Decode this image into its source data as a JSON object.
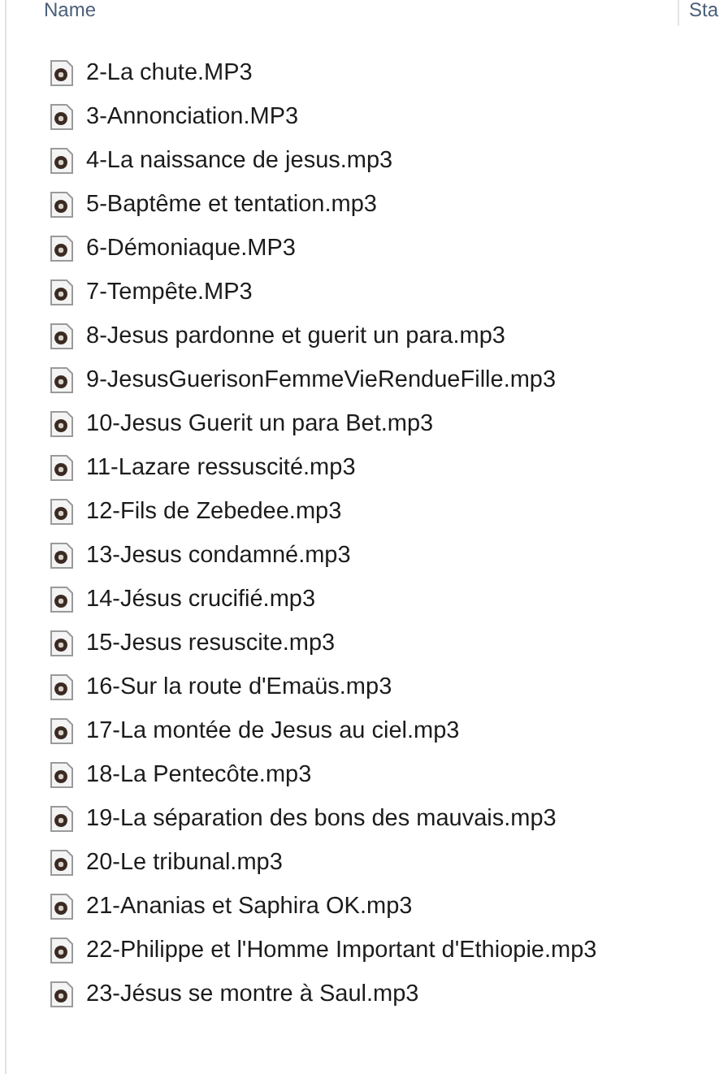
{
  "columns": [
    {
      "label": "Name"
    },
    {
      "label": "Sta"
    }
  ],
  "files": [
    {
      "name": "2-La chute.MP3"
    },
    {
      "name": "3-Annonciation.MP3"
    },
    {
      "name": "4-La naissance de jesus.mp3"
    },
    {
      "name": "5-Baptême et tentation.mp3"
    },
    {
      "name": "6-Démoniaque.MP3"
    },
    {
      "name": "7-Tempête.MP3"
    },
    {
      "name": "8-Jesus pardonne et guerit un para.mp3"
    },
    {
      "name": "9-JesusGuerisonFemmeVieRendueFille.mp3"
    },
    {
      "name": "10-Jesus Guerit un para Bet.mp3"
    },
    {
      "name": "11-Lazare ressuscité.mp3"
    },
    {
      "name": "12-Fils de Zebedee.mp3"
    },
    {
      "name": "13-Jesus condamné.mp3"
    },
    {
      "name": "14-Jésus crucifié.mp3"
    },
    {
      "name": "15-Jesus resuscite.mp3"
    },
    {
      "name": "16-Sur la route d'Emaüs.mp3"
    },
    {
      "name": "17-La montée de Jesus au ciel.mp3"
    },
    {
      "name": "18-La Pentecôte.mp3"
    },
    {
      "name": "19-La séparation des bons des mauvais.mp3"
    },
    {
      "name": "20-Le tribunal.mp3"
    },
    {
      "name": "21-Ananias et Saphira OK.mp3"
    },
    {
      "name": "22-Philippe et l'Homme Important d'Ethiopie.mp3"
    },
    {
      "name": "23-Jésus se montre à Saul.mp3"
    }
  ]
}
